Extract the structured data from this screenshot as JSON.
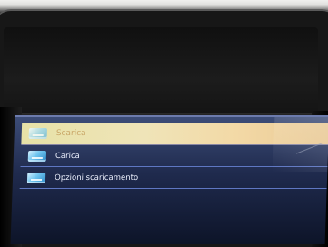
{
  "screen": {
    "title": "",
    "menu": {
      "items": [
        {
          "label": "Scarica",
          "icon": "download-tray-icon",
          "selected": true
        },
        {
          "label": "Carica",
          "icon": "upload-tray-icon",
          "selected": false
        },
        {
          "label": "Opzioni scaricamento",
          "icon": "options-tray-icon",
          "selected": false
        }
      ]
    }
  },
  "colors": {
    "selection": "#efe4b8",
    "menu_background": "#1f2a4d",
    "divider": "#5f77c2"
  }
}
